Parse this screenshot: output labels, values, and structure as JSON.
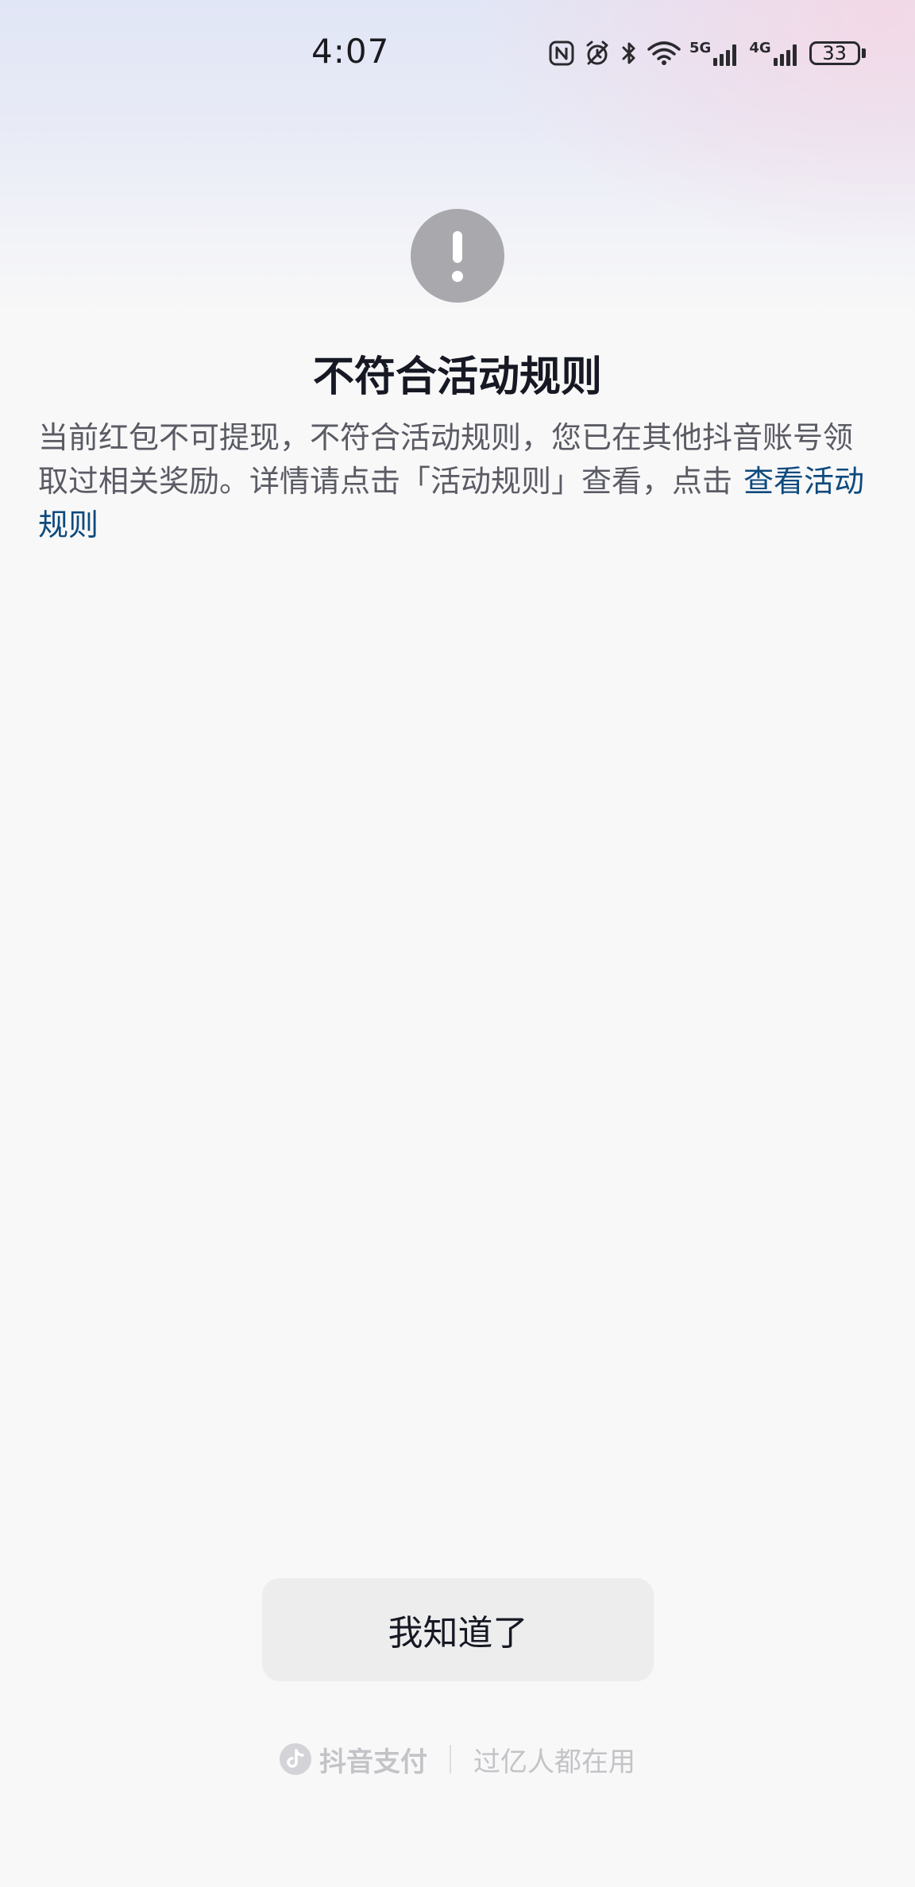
{
  "status_bar": {
    "time": "4:07",
    "network_5g": "5G",
    "network_4g": "4G",
    "battery": "33"
  },
  "dialog": {
    "title": "不符合活动规则",
    "message": "当前红包不可提现，不符合活动规则，您已在其他抖音账号领取过相关奖励。详情请点击「活动规则」查看，点击",
    "link_label": "查看活动规则",
    "confirm_label": "我知道了"
  },
  "footer": {
    "brand": "抖音支付",
    "slogan": "过亿人都在用"
  },
  "colors": {
    "link": "#0e4a7e",
    "alert_icon": "#a8a8ad",
    "button_bg": "#ededed"
  }
}
